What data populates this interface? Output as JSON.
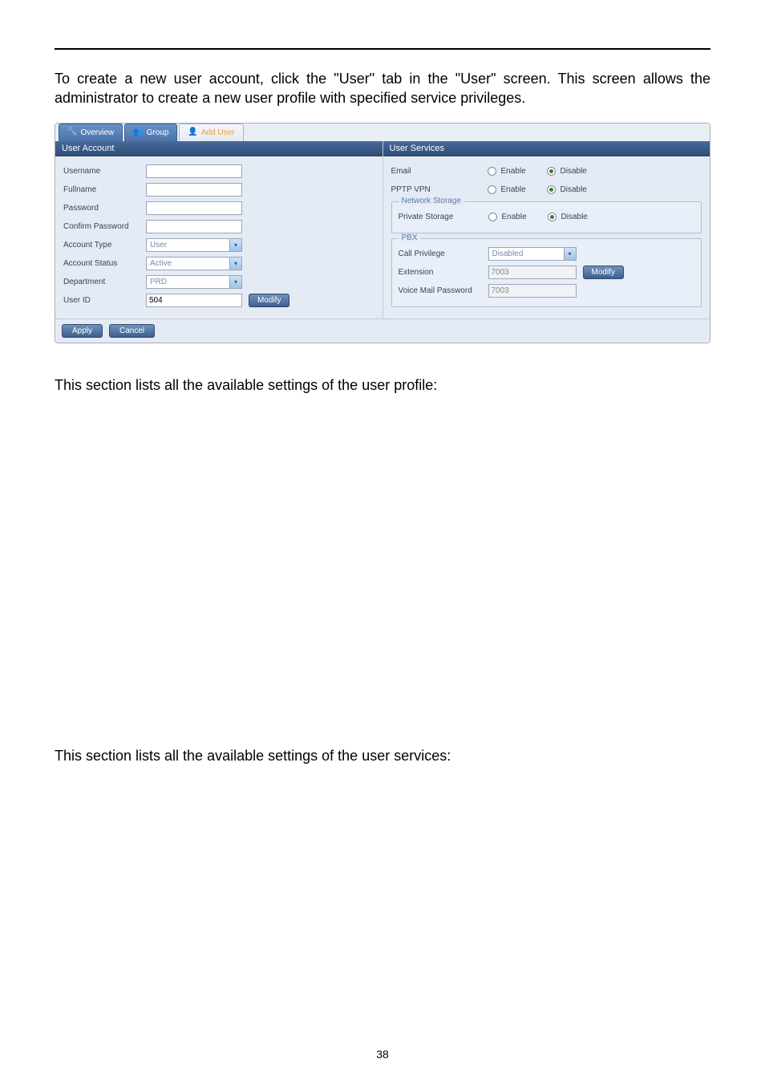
{
  "doc": {
    "intro": "To create a new user account, click the \"User\" tab in the \"User\" screen. This screen allows the administrator to create a new user profile with specified service privileges.",
    "section_profile": "This section lists all the available settings of the user profile:",
    "section_services": "This section lists all the available settings of the user services:",
    "page_number": "38"
  },
  "tabs": {
    "overview": "Overview",
    "group": "Group",
    "add_user": "Add User"
  },
  "left": {
    "header": "User Account",
    "labels": {
      "username": "Username",
      "fullname": "Fullname",
      "password": "Password",
      "confirm": "Confirm Password",
      "account_type": "Account Type",
      "account_status": "Account Status",
      "department": "Department",
      "user_id": "User ID"
    },
    "values": {
      "username": "",
      "fullname": "",
      "password": "",
      "confirm": "",
      "account_type": "User",
      "account_status": "Active",
      "department": "PRD",
      "user_id": "504"
    },
    "modify_btn": "Modify"
  },
  "right": {
    "header": "User Services",
    "labels": {
      "email": "Email",
      "pptp": "PPTP VPN",
      "network_storage_legend": "Network Storage",
      "private_storage": "Private Storage",
      "pbx_legend": "PBX",
      "call_privilege": "Call Privilege",
      "extension": "Extension",
      "voice_mail_pw": "Voice Mail Password",
      "enable": "Enable",
      "disable": "Disable"
    },
    "values": {
      "email_selected": "disable",
      "pptp_selected": "disable",
      "private_storage_selected": "disable",
      "call_privilege": "Disabled",
      "extension": "7003",
      "voice_mail_pw": "7003"
    },
    "modify_btn": "Modify"
  },
  "bottom": {
    "apply": "Apply",
    "cancel": "Cancel"
  }
}
